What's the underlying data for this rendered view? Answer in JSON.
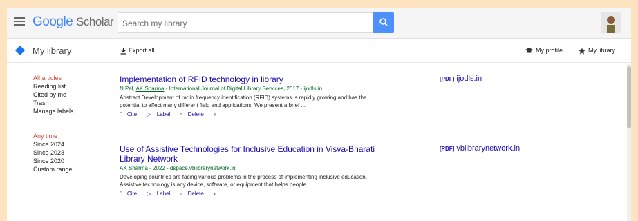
{
  "header": {
    "logo_google": "Google",
    "logo_scholar": "Scholar",
    "search_placeholder": "Search my library"
  },
  "subbar": {
    "title": "My library",
    "export_label": "Export all",
    "my_profile_label": "My profile",
    "my_library_label": "My library"
  },
  "nav": {
    "filters": [
      "All articles",
      "Reading list",
      "Cited by me",
      "Trash",
      "Manage labels..."
    ],
    "time": [
      "Any time",
      "Since 2024",
      "Since 2023",
      "Since 2020",
      "Custom range..."
    ]
  },
  "results": [
    {
      "title": "Implementation of RFID technology in library",
      "authors_pre": "N Pal, ",
      "author_link": "AK Sharma",
      "source": " - International Journal of Digital Library Services, 2017 - ijodls.in",
      "snippet": "Abstract Development of radio frequency identification (RFID) systems is rapidly growing and has the potential to affect many different field and applications. We present a brief ...",
      "pdf_tag": "[PDF]",
      "pdf_domain": "ijodls.in",
      "cite": "Cite",
      "label": "Label",
      "delete": "Delete"
    },
    {
      "title": "Use of Assistive Technologies for Inclusive Education in Visva-Bharati Library Network",
      "authors_pre": "",
      "author_link": "AK Sharma",
      "source": " - 2022 - dspace.vblibrarynetwork.in",
      "snippet": "Developing countries are facing various problems in the process of implementing inclusive education. Assistive technology is any device, software, or equipment that helps people ...",
      "pdf_tag": "[PDF]",
      "pdf_domain": "vblibrarynetwork.in",
      "cite": "Cite",
      "label": "Label",
      "delete": "Delete"
    }
  ]
}
